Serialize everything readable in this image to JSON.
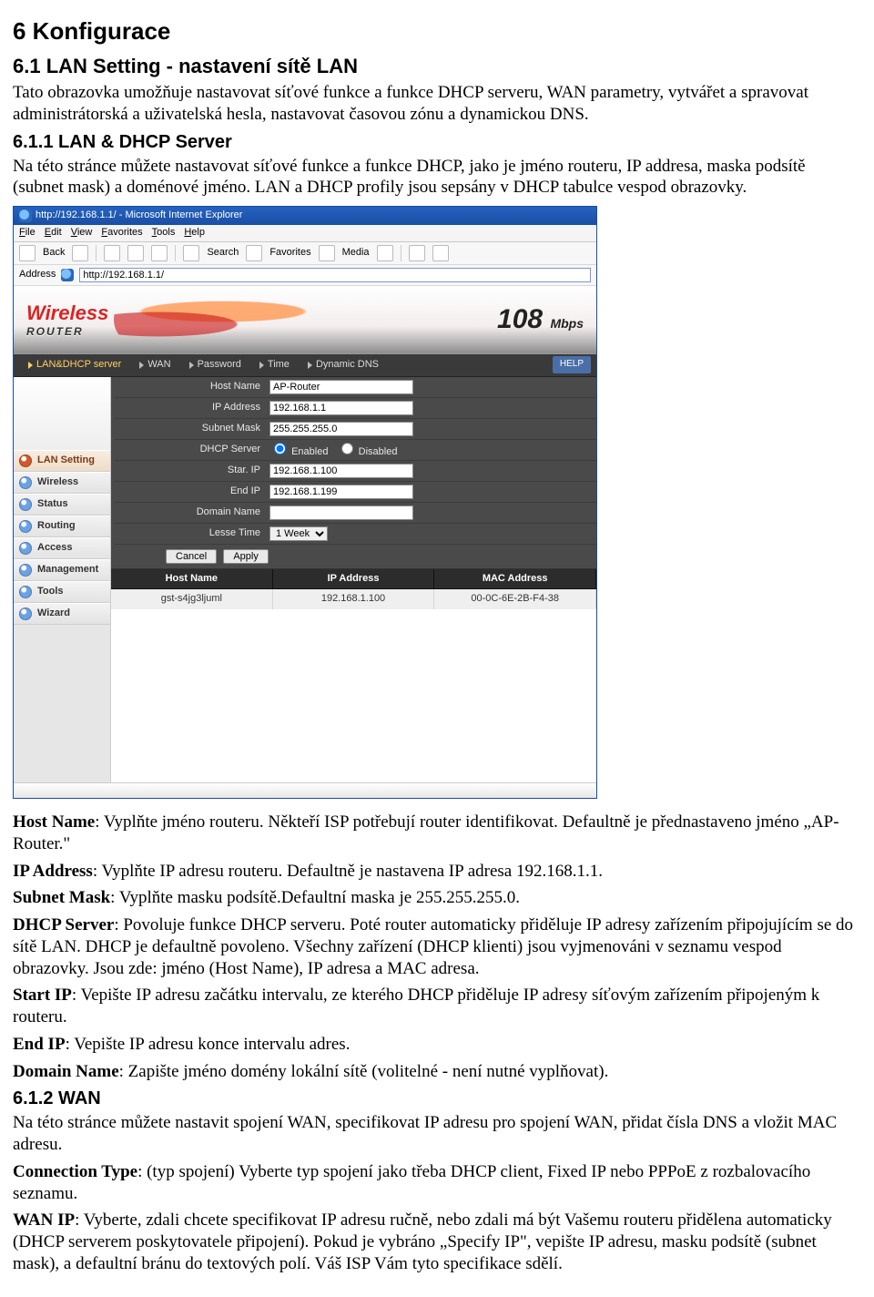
{
  "doc": {
    "h1": "6 Konfigurace",
    "h2": "6.1 LAN Setting - nastavení sítě LAN",
    "p1": "Tato obrazovka umožňuje nastavovat síťové funkce a funkce DHCP serveru, WAN parametry, vytvářet a spravovat administrátorská a uživatelská hesla, nastavovat časovou zónu a dynamickou DNS.",
    "h3a": "6.1.1 LAN & DHCP Server",
    "p2": "Na této stránce můžete nastavovat síťové funkce a funkce DHCP, jako je jméno routeru, IP addresa, maska podsítě (subnet mask) a doménové jméno. LAN a DHCP profily jsou sepsány v DHCP tabulce vespod obrazovky.",
    "hn_l": "Host Name",
    "hn_t": ": Vyplňte jméno routeru. Někteří ISP potřebují router identifikovat. Defaultně je přednastaveno jméno „AP-Router.\"",
    "ip_l": "IP Address",
    "ip_t": ": Vyplňte IP adresu routeru. Defaultně je nastavena IP adresa 192.168.1.1.",
    "sm_l": "Subnet Mask",
    "sm_t": ": Vyplňte masku podsítě.Defaultní maska je 255.255.255.0.",
    "ds_l": "DHCP Server",
    "ds_t": ": Povoluje funkce DHCP serveru. Poté router automaticky přiděluje IP adresy zařízením připojujícím se do sítě LAN. DHCP je defaultně povoleno. Všechny zařízení (DHCP klienti) jsou vyjmenováni v seznamu vespod obrazovky. Jsou zde: jméno (Host Name), IP adresa a MAC adresa.",
    "si_l": "Start IP",
    "si_t": ": Vepište IP adresu začátku intervalu, ze kterého DHCP přiděluje IP adresy síťovým zařízením připojeným k routeru.",
    "ei_l": "End IP",
    "ei_t": ": Vepište IP adresu konce intervalu adres.",
    "dn_l": "Domain Name",
    "dn_t": ": Zapište jméno domény lokální sítě (volitelné - není nutné vyplňovat).",
    "h3b": "6.1.2 WAN",
    "p3": "Na této stránce můžete nastavit spojení WAN, specifikovat IP adresu pro spojení WAN, přidat čísla DNS a vložit MAC adresu.",
    "ct_l": "Connection Type",
    "ct_t": ": (typ spojení) Vyberte typ spojení jako třeba DHCP client, Fixed IP nebo PPPoE z rozbalovacího seznamu.",
    "wi_l": "WAN IP",
    "wi_t": ": Vyberte, zdali chcete specifikovat IP adresu ručně, nebo zdali má být Vašemu routeru přidělena automaticky (DHCP serverem poskytovatele připojení). Pokud je vybráno „Specify IP\", vepište IP adresu, masku podsítě (subnet mask), a defaultní bránu do textových polí. Váš ISP Vám tyto specifikace sdělí."
  },
  "ie": {
    "title": "http://192.168.1.1/ - Microsoft Internet Explorer",
    "menu": [
      "File",
      "Edit",
      "View",
      "Favorites",
      "Tools",
      "Help"
    ],
    "tool": {
      "back": "Back",
      "search": "Search",
      "fav": "Favorites",
      "media": "Media"
    },
    "addr_label": "Address",
    "addr_value": "http://192.168.1.1/"
  },
  "router": {
    "logo_top": "Wireless",
    "logo_bot": "ROUTER",
    "mbps_num": "108",
    "mbps_unit": "Mbps",
    "tabs": [
      "LAN&DHCP server",
      "WAN",
      "Password",
      "Time",
      "Dynamic DNS"
    ],
    "help": "HELP",
    "side": [
      "LAN Setting",
      "Wireless",
      "Status",
      "Routing",
      "Access",
      "Management",
      "Tools",
      "Wizard"
    ],
    "labels": {
      "host": "Host Name",
      "ip": "IP Address",
      "mask": "Subnet Mask",
      "dhcp": "DHCP Server",
      "sip": "Star. IP",
      "eip": "End IP",
      "dom": "Domain Name",
      "lease": "Lesse Time",
      "en": "Enabled",
      "dis": "Disabled"
    },
    "values": {
      "host": "AP-Router",
      "ip": "192.168.1.1",
      "mask": "255.255.255.0",
      "sip": "192.168.1.100",
      "eip": "192.168.1.199",
      "dom": "",
      "lease": "1 Week"
    },
    "buttons": {
      "cancel": "Cancel",
      "apply": "Apply"
    },
    "table": {
      "h1": "Host Name",
      "h2": "IP Address",
      "h3": "MAC Address",
      "r1c1": "gst-s4jg3ljuml",
      "r1c2": "192.168.1.100",
      "r1c3": "00-0C-6E-2B-F4-38"
    }
  }
}
